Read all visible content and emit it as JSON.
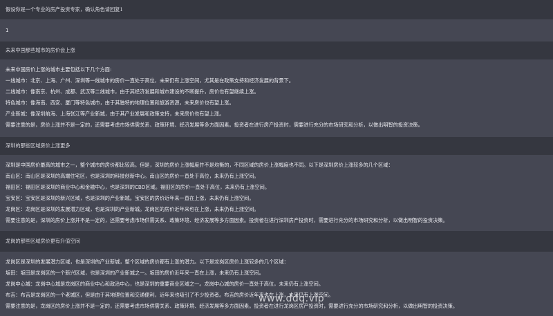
{
  "conversation": [
    {
      "role": "user",
      "text": "假设你是一个专业的房产投资专家，确认角色请回复1"
    },
    {
      "role": "assistant",
      "lines": [
        "1"
      ]
    },
    {
      "role": "user",
      "text": "未来中国那些城市的房价会上涨"
    },
    {
      "role": "assistant",
      "lines": [
        "未来中国房价上涨的城市主要包括以下几个方面:",
        "一线城市：北京、上海、广州、深圳等一线城市的房价一直处于高位，未来仍有上涨空间，尤其是在政策支持和经济发展的背景下。",
        "二线城市：像南京、杭州、成都、武汉等二线城市，由于其经济发展和城市建设的不断提升，房价也有望继续上涨。",
        "特色城市：像海南、西安、厦门等特色城市，由于其独特的地理位置和旅游资源，未来房价也有望上涨。",
        "产业新城：像深圳前海、上海张江等产业新城，由于其产业发展和政策支持，未来房价也有望上涨。",
        "需要注意的是，房价上涨并不是一定的，还需要考虑市场供需关系、政策环境、经济发展等多方面因素。投资者在进行房产投资时，需要进行充分的市场研究和分析，以做出明智的投资决策。"
      ]
    },
    {
      "role": "user",
      "text": "深圳的那些区域房价上涨更多"
    },
    {
      "role": "assistant",
      "lines": [
        "深圳是中国房价最高的城市之一，整个城市的房价都比较高。但是，深圳的房价上涨幅度并不是均衡的，不同区域的房价上涨幅度也不同。以下是深圳房价上涨较多的几个区域：",
        "南山区：南山区是深圳的高端住宅区，也是深圳的科技创新中心。南山区的房价一直处于高位，未来仍有上涨空间。",
        "福田区：福田区是深圳的商业中心和金融中心，也是深圳的CBD区域。福田区的房价一直处于高位，未来仍有上涨空间。",
        "宝安区：宝安区是深圳的新兴区域，也是深圳的产业新城。宝安区的房价近年来一直在上涨，未来仍有上涨空间。",
        "龙岗区：龙岗区是深圳的发展潜力区域，也是深圳的产业新城。龙岗区的房价近年来也在上涨，未来仍有上涨空间。",
        "需要注意的是，深圳的房价上涨并不是一定的，还需要考虑市场供需关系、政策环境、经济发展等多方面因素。投资者在进行深圳房产投资时，需要进行充分的市场研究和分析，以做出明智的投资决策。"
      ]
    },
    {
      "role": "user",
      "text": "龙岗的那些区域房价更有升值空间"
    },
    {
      "role": "assistant",
      "lines": [
        "龙岗区是深圳的发展潜力区域，也是深圳的产业新城，整个区域的房价都有上涨的潜力。以下是龙岗区房价上涨较多的几个区域：",
        "坂田：坂田是龙岗区的一个新兴区域，也是深圳的产业新城之一。坂田的房价近年来一直在上涨，未来仍有上涨空间。",
        "龙岗中心城：龙岗中心城是龙岗区的商业中心和政治中心，也是深圳的重要商业区域之一。龙岗中心城的房价一直处于高位，未来仍有上涨空间。",
        "布吉：布吉是龙岗区的一个老城区，但是由于其地理位置和交通便利，近年来也吸引了不少投资者。布吉的房价近年来也在上涨，未来仍有上涨空间。",
        "需要注意的是，龙岗区的房价上涨并不是一定的，还需要考虑市场供需关系、政策环境、经济发展等多方面因素。投资者在进行龙岗区房产投资时，需要进行充分的市场研究和分析，以做出明智的投资决策。"
      ]
    }
  ],
  "watermark": "www.ddq.vip"
}
